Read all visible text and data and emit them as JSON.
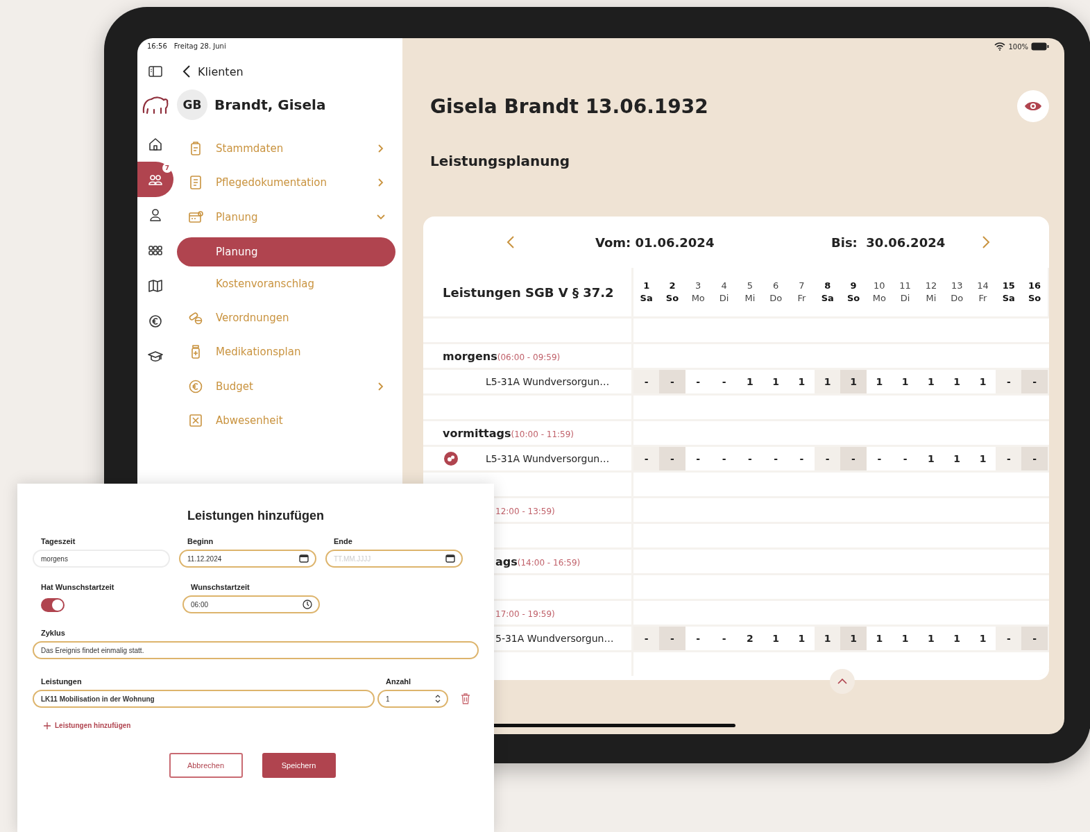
{
  "status_bar": {
    "time": "16:56",
    "date": "Freitag 28. Juni",
    "battery": "100%"
  },
  "rail": [
    {
      "kind": "home",
      "selected": false
    },
    {
      "kind": "clients",
      "selected": true,
      "badge": "7"
    },
    {
      "kind": "person",
      "selected": false
    },
    {
      "kind": "grid",
      "selected": false
    },
    {
      "kind": "map",
      "selected": false
    },
    {
      "kind": "euro",
      "selected": false
    },
    {
      "kind": "cap",
      "selected": false
    }
  ],
  "back_link": "Klienten",
  "client": {
    "initials": "GB",
    "name": "Brandt, Gisela"
  },
  "menu": [
    {
      "kind": "clipboard",
      "label": "Stammdaten",
      "expanded": false
    },
    {
      "kind": "document",
      "label": "Pflegedokumentation",
      "expanded": false
    },
    {
      "kind": "calendar",
      "label": "Planung",
      "expanded": true,
      "children": [
        {
          "label": "Planung",
          "selected": true
        },
        {
          "label": "Kostenvoranschlag",
          "selected": false
        }
      ]
    },
    {
      "kind": "pills",
      "label": "Verordnungen"
    },
    {
      "kind": "bottle",
      "label": "Medikationsplan"
    },
    {
      "kind": "euro",
      "label": "Budget",
      "expanded": false
    },
    {
      "kind": "xbox",
      "label": "Abwesenheit"
    }
  ],
  "header": {
    "title": "Gisela Brandt 13.06.1932",
    "subtitle": "Leistungsplanung"
  },
  "period": {
    "from": "Vom: 01.06.2024",
    "to": "Bis:  30.06.2024"
  },
  "table": {
    "title": "Leistungen SGB V § 37.2",
    "days": [
      {
        "number": "1",
        "weekday": "Sa",
        "kind": "saturday"
      },
      {
        "number": "2",
        "weekday": "So",
        "kind": "sunday"
      },
      {
        "number": "3",
        "weekday": "Mo",
        "kind": "weekday"
      },
      {
        "number": "4",
        "weekday": "Di",
        "kind": "weekday"
      },
      {
        "number": "5",
        "weekday": "Mi",
        "kind": "weekday"
      },
      {
        "number": "6",
        "weekday": "Do",
        "kind": "weekday"
      },
      {
        "number": "7",
        "weekday": "Fr",
        "kind": "weekday"
      },
      {
        "number": "8",
        "weekday": "Sa",
        "kind": "saturday"
      },
      {
        "number": "9",
        "weekday": "So",
        "kind": "sunday"
      },
      {
        "number": "10",
        "weekday": "Mo",
        "kind": "weekday"
      },
      {
        "number": "11",
        "weekday": "Di",
        "kind": "weekday"
      },
      {
        "number": "12",
        "weekday": "Mi",
        "kind": "weekday"
      },
      {
        "number": "13",
        "weekday": "Do",
        "kind": "weekday"
      },
      {
        "number": "14",
        "weekday": "Fr",
        "kind": "weekday"
      },
      {
        "number": "15",
        "weekday": "Sa",
        "kind": "saturday"
      },
      {
        "number": "16",
        "weekday": "So",
        "kind": "sunday"
      }
    ],
    "groups": [
      {
        "name": "morgens",
        "time": "(06:00 - 09:59)",
        "covered": false,
        "items": [
          {
            "name": "L5-31A Wundversorgun…",
            "flagged": false,
            "values": [
              "-",
              "-",
              "-",
              "-",
              "1",
              "1",
              "1",
              "1",
              "1",
              "1",
              "1",
              "1",
              "1",
              "1",
              "-",
              "-"
            ]
          }
        ]
      },
      {
        "name": "vormittags",
        "time": "(10:00 - 11:59)",
        "covered": false,
        "items": [
          {
            "name": "L5-31A Wundversorgun…",
            "flagged": true,
            "values": [
              "-",
              "-",
              "-",
              "-",
              "-",
              "-",
              "-",
              "-",
              "-",
              "-",
              "-",
              "1",
              "1",
              "1",
              "-",
              "-"
            ]
          }
        ]
      },
      {
        "time": "12:00 - 13:59)",
        "covered": true
      },
      {
        "name": "ags",
        "time": "(14:00 - 16:59)",
        "covered": true
      },
      {
        "time": "17:00 - 19:59)",
        "covered": true,
        "items": [
          {
            "name": "5-31A Wundversorgun…",
            "flagged": false,
            "values": [
              "-",
              "-",
              "-",
              "-",
              "2",
              "1",
              "1",
              "1",
              "1",
              "1",
              "1",
              "1",
              "1",
              "1",
              "-",
              "-"
            ]
          }
        ]
      }
    ]
  },
  "dialog": {
    "title": "Leistungen hinzufügen",
    "row1": [
      {
        "label": "Tageszeit",
        "kind": "text",
        "value": "morgens",
        "disabled": true
      },
      {
        "label": "Beginn",
        "kind": "date",
        "value": "11.12.2024",
        "disabled": false
      },
      {
        "label": "Ende",
        "kind": "date",
        "placeholder": "TT.MM.JJJJ",
        "disabled": false
      }
    ],
    "toggle": {
      "label": "Hat Wunschstartzeit",
      "on": true
    },
    "start_time": {
      "label": "Wunschstartzeit",
      "kind": "time",
      "value": "06:00",
      "disabled": false
    },
    "cycle": {
      "label": "Zyklus",
      "value": "Das Ereignis findet einmalig statt."
    },
    "service": {
      "label": "Leistungen",
      "value": "LK11 Mobilisation in der Wohnung"
    },
    "count": {
      "label": "Anzahl",
      "value": "1"
    },
    "add_link": "Leistungen hinzufügen",
    "cancel": "Abbrechen",
    "save": "Speichern"
  }
}
